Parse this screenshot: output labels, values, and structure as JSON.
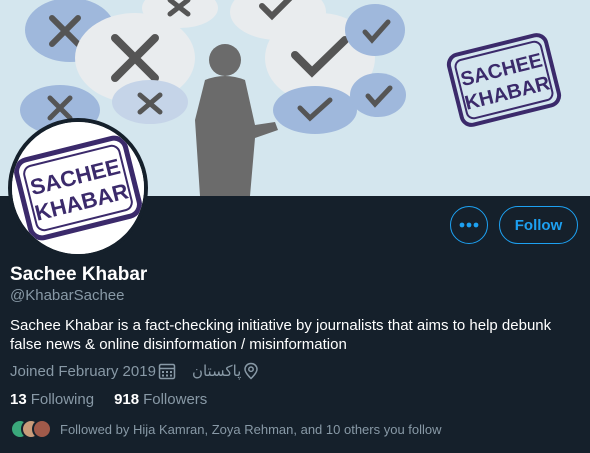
{
  "banner": {
    "logo_line1": "SACHEE",
    "logo_line2": "KHABAR"
  },
  "avatar": {
    "logo_line1": "SACHEE",
    "logo_line2": "KHABAR"
  },
  "actions": {
    "more_icon": "more-dots-icon",
    "follow_label": "Follow"
  },
  "profile": {
    "name": "Sachee Khabar",
    "handle": "@KhabarSachee",
    "bio": "Sachee Khabar is a fact-checking initiative by journalists that aims to help debunk false news & online disinformation / misinformation",
    "joined": "Joined February 2019",
    "location": "پاکستان"
  },
  "stats": {
    "following_count": "13",
    "following_label": "Following",
    "followers_count": "918",
    "followers_label": "Followers"
  },
  "followed_by": {
    "text": "Followed by Hija Kamran, Zoya Rehman, and 10 others you follow"
  },
  "colors": {
    "background": "#15202b",
    "accent": "#1da1f2",
    "secondary_text": "#8899a6",
    "logo_purple": "#3b2a6b"
  }
}
